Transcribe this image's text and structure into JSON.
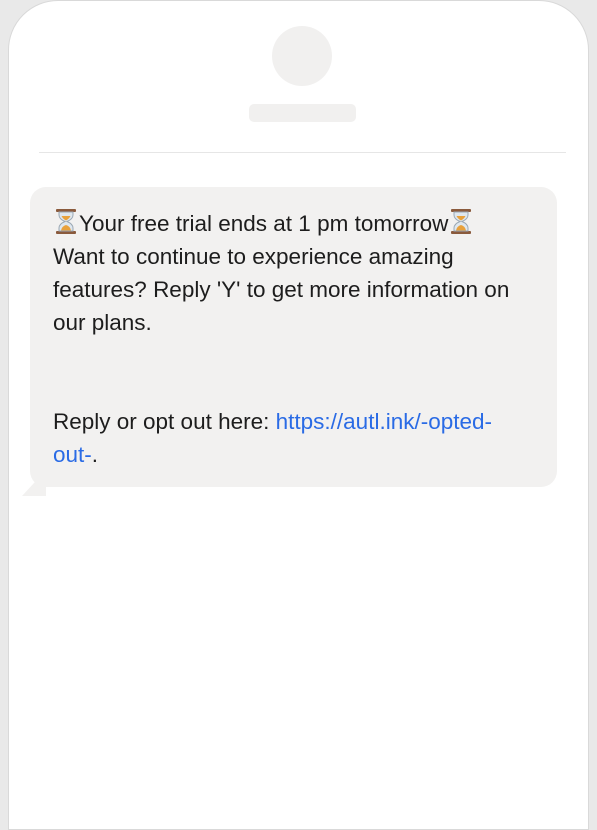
{
  "message": {
    "line1_text": "Your free trial ends at 1 pm tomorrow",
    "line1_icon": "hourglass-icon",
    "line2": "Want to continue to experience amazing",
    "line3": "features? Reply 'Y' to get more information on",
    "line4": "our plans.",
    "optout_prefix": "Reply or opt out here: ",
    "optout_link_part1": "https://autl.ink/-opted-",
    "optout_link_part2": "out-",
    "optout_suffix": "."
  },
  "colors": {
    "bubble": "#f2f1f0",
    "text": "#1d1d1d",
    "link": "#2a6be5",
    "placeholder": "#f1f0ef"
  }
}
